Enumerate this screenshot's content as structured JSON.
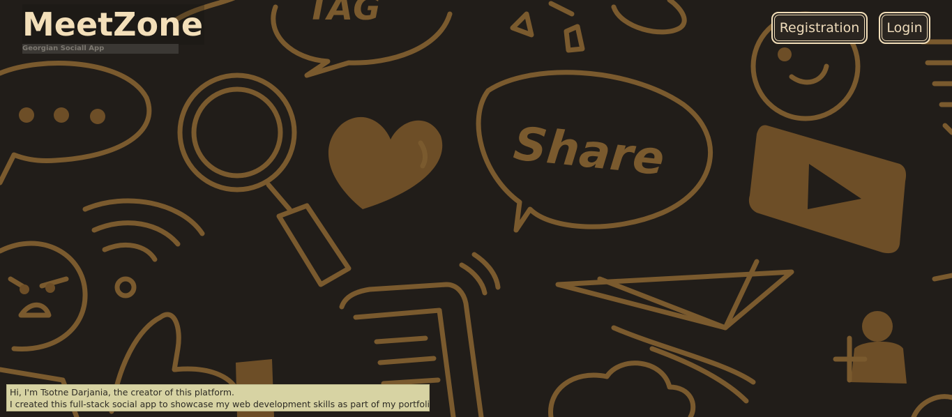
{
  "brand": {
    "title": "MeetZone",
    "subtitle": "Georgian Sociall App"
  },
  "nav": {
    "registration_label": "Registration",
    "login_label": "Login"
  },
  "background": {
    "words": [
      "TAG",
      "Share"
    ],
    "icons": [
      "speech-bubble-icon",
      "magnifier-icon",
      "heart-icon",
      "smiley-icon",
      "play-icon",
      "wifi-icon",
      "angry-face-icon",
      "phone-icon",
      "paper-plane-icon",
      "add-user-icon",
      "cloud-icon",
      "thumbs-up-icon"
    ]
  },
  "intro": {
    "line1": "Hi, I'm Tsotne Darjania, the creator of this platform.",
    "line2": "I created this full-stack social app to showcase my web development skills as part of my portfolio."
  },
  "colors": {
    "background": "#211d19",
    "doodle": "#7a5a2e",
    "accent": "#f3dfb9",
    "note_bg": "#d7d3a3"
  }
}
